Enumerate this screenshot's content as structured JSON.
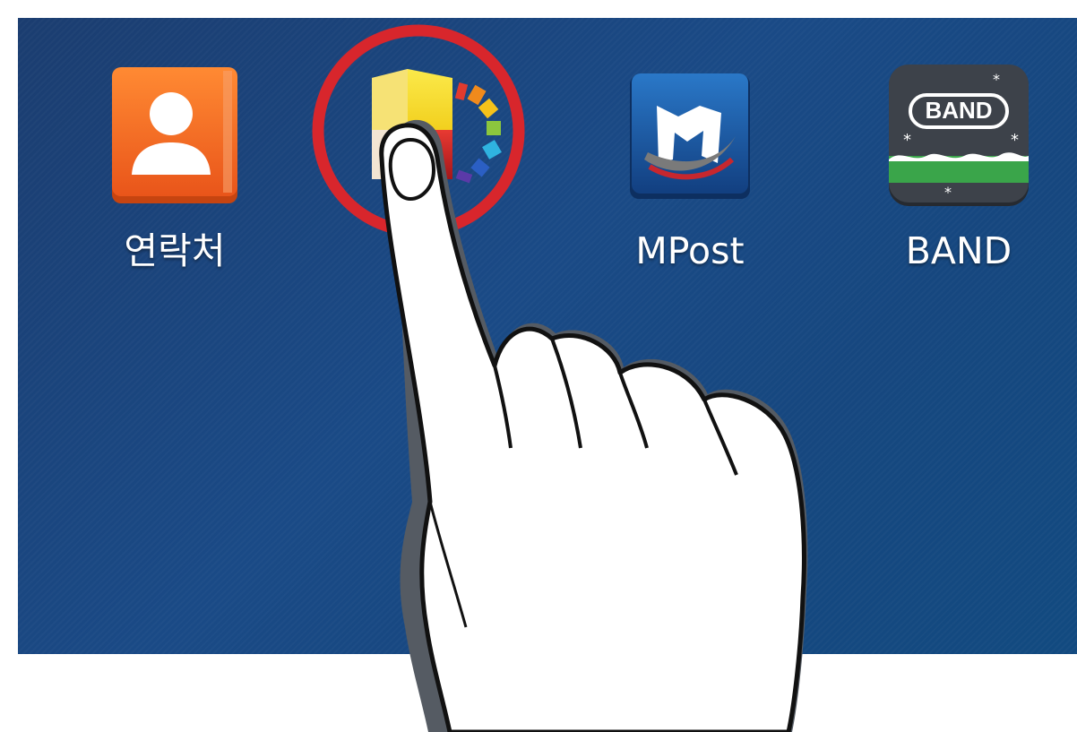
{
  "home_screen": {
    "apps": [
      {
        "label": "연락처",
        "icon": "contacts-icon",
        "color": "#f26a1b"
      },
      {
        "label": "",
        "icon": "colorful-cube-app-icon",
        "color": "#e8d23a"
      },
      {
        "label": "MPost",
        "icon": "mpost-icon",
        "color": "#1f5ca6"
      },
      {
        "label": "BAND",
        "icon": "band-icon",
        "color": "#3a3f47"
      }
    ],
    "band_icon_text": "BAND"
  },
  "overlay": {
    "highlight_ring_color": "#d8262c",
    "pointer": "tapping-hand"
  }
}
